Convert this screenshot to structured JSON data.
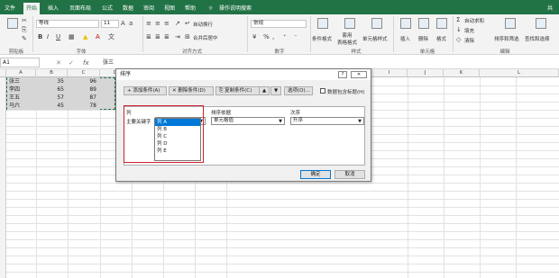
{
  "tabs": [
    "文件",
    "开始",
    "插入",
    "页面布局",
    "公式",
    "数据",
    "审阅",
    "视图",
    "帮助"
  ],
  "search_hint": "操作说明搜索",
  "user_initial": "共",
  "ribbon": {
    "font_name": "等线",
    "font_size": "11",
    "wrap_text": "自动换行",
    "merge": "合并后居中",
    "number_format": "常规",
    "cond_format": "条件格式",
    "table_format": "套用\n表格格式",
    "cell_style": "单元格样式",
    "insert": "插入",
    "delete": "删除",
    "format": "格式",
    "autosum": "自动求和",
    "fill": "填充",
    "clear": "清除",
    "sort_filter": "排序和筛选",
    "find_select": "查找和选择",
    "groups": {
      "clipboard": "剪贴板",
      "font": "字体",
      "alignment": "对齐方式",
      "number": "数字",
      "styles": "样式",
      "cells": "单元格",
      "editing": "编辑"
    }
  },
  "namebox": "A1",
  "formula_value": "张三",
  "columns": [
    "A",
    "B",
    "C",
    "D",
    "E",
    "F",
    "G",
    "H",
    "I",
    "J",
    "K",
    "L"
  ],
  "rows": [
    {
      "name": "张三",
      "b": "35",
      "c": "96"
    },
    {
      "name": "李四",
      "b": "65",
      "c": "89"
    },
    {
      "name": "王五",
      "b": "57",
      "c": "87"
    },
    {
      "name": "马六",
      "b": "45",
      "c": "78"
    }
  ],
  "dialog": {
    "title": "排序",
    "help": "?",
    "close": "✕",
    "add_level": "添加条件(A)",
    "delete_level": "删除条件(D)",
    "copy_level": "复制条件(C)",
    "options": "选项(O)...",
    "has_header": "数据包含标题(H)",
    "col_header": "列",
    "sort_on_header": "排序依据",
    "order_header": "次序",
    "primary_key": "主要关键字",
    "sort_on_value": "单元格值",
    "order_value": "升序",
    "dropdown_items": [
      "列 A",
      "列 B",
      "列 C",
      "列 D",
      "列 E"
    ],
    "ok": "确定",
    "cancel": "取消"
  }
}
